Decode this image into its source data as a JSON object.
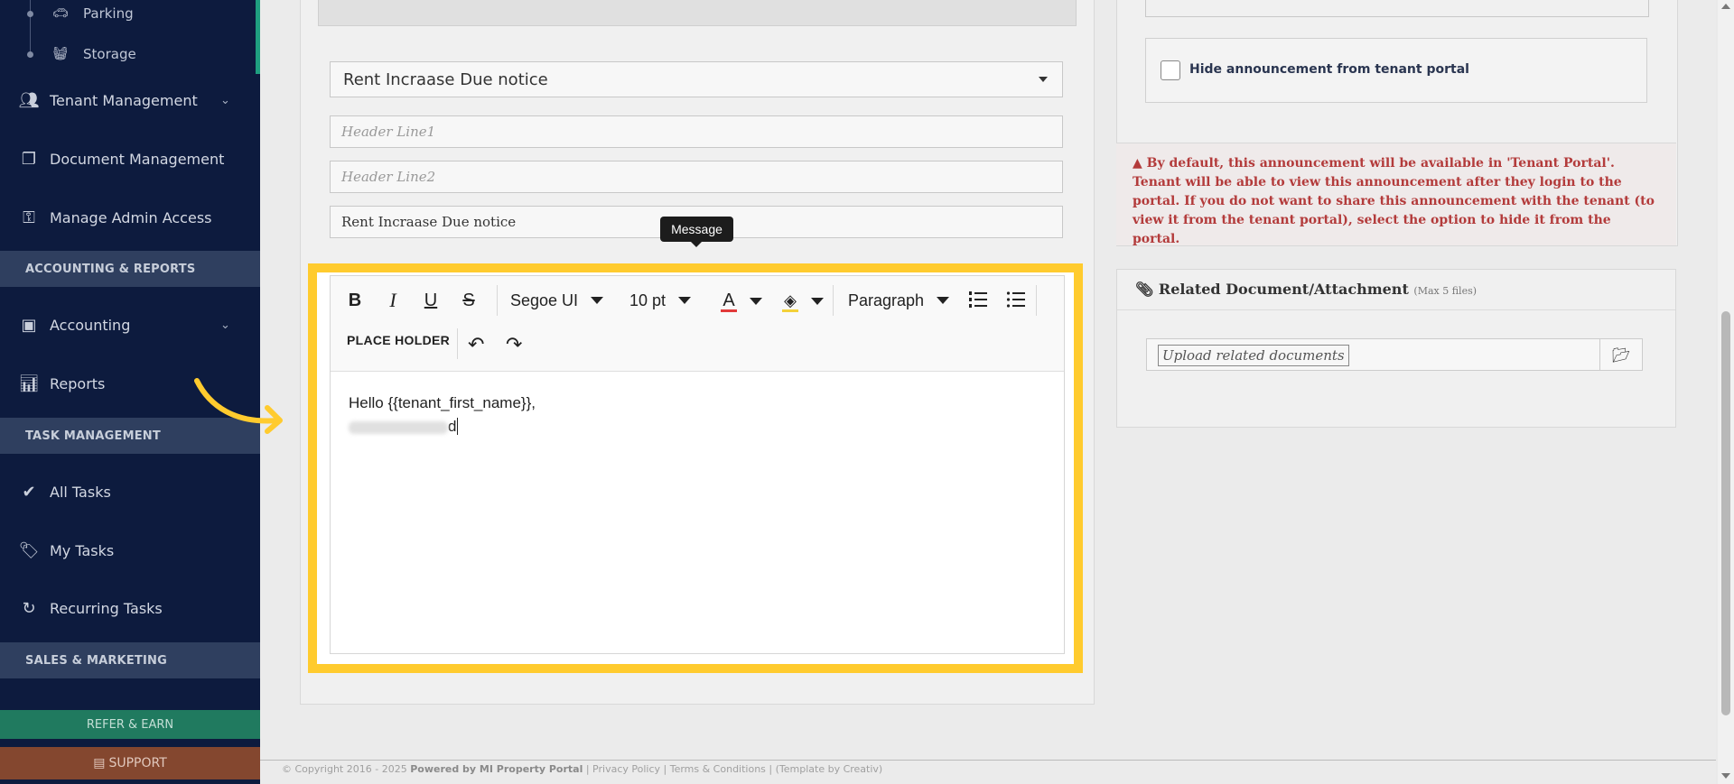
{
  "sidebar": {
    "sub_items": [
      {
        "label": "Parking",
        "icon": "car-icon"
      },
      {
        "label": "Storage",
        "icon": "basket-icon"
      }
    ],
    "items": [
      {
        "label": "Tenant Management",
        "icon": "users-icon",
        "has_chevron": true
      },
      {
        "label": "Document Management",
        "icon": "documents-icon",
        "has_chevron": false
      },
      {
        "label": "Manage Admin Access",
        "icon": "key-icon",
        "has_chevron": false
      },
      {
        "label": "Accounting",
        "icon": "money-icon",
        "has_chevron": true
      },
      {
        "label": "Reports",
        "icon": "bar-chart-icon",
        "has_chevron": false
      },
      {
        "label": "All Tasks",
        "icon": "check-icon",
        "has_chevron": false
      },
      {
        "label": "My Tasks",
        "icon": "tag-icon",
        "has_chevron": false
      },
      {
        "label": "Recurring Tasks",
        "icon": "refresh-icon",
        "has_chevron": false
      }
    ],
    "sections": {
      "accounting": "ACCOUNTING & REPORTS",
      "tasks": "TASK MANAGEMENT",
      "sales": "SALES & MARKETING"
    },
    "refer_label": "REFER & EARN",
    "support_label": "SUPPORT"
  },
  "form": {
    "template_select": "Rent Incraase Due notice",
    "header_line1_placeholder": "Header Line1",
    "header_line2_placeholder": "Header Line2",
    "subject_value": "Rent Incraase Due notice"
  },
  "tooltip": "Message",
  "editor": {
    "font_family": "Segoe UI",
    "font_size": "10 pt",
    "block_format": "Paragraph",
    "place_holder_label": "PLACE HOLDER",
    "content_line1": "Hello {{tenant_first_name}},",
    "content_line2_end": "d"
  },
  "right": {
    "hide_label": "Hide announcement from tenant portal",
    "warning_text": "By default, this announcement will be available in 'Tenant Portal'. Tenant will be able to view this announcement after they login to the portal. If you do not want to share this announcement with the tenant (to view it from the tenant portal), select the option to hide it from the portal.",
    "doc_title": "Related Document/Attachment",
    "doc_subtitle": "(Max 5 files)",
    "upload_placeholder": "Upload related documents"
  },
  "footer": {
    "copyright": "© Copyright 2016 - 2025",
    "powered": "Powered by MI Property Portal",
    "privacy": "Privacy Policy",
    "terms": "Terms & Conditions",
    "template": "(Template by Creativ)"
  },
  "colors": {
    "sidebar_bg": "#0d1b3e",
    "highlight": "#ffcb2e",
    "warning_text": "#b33b3b",
    "refer_bg": "#207a5f",
    "support_bg": "#84472f"
  }
}
